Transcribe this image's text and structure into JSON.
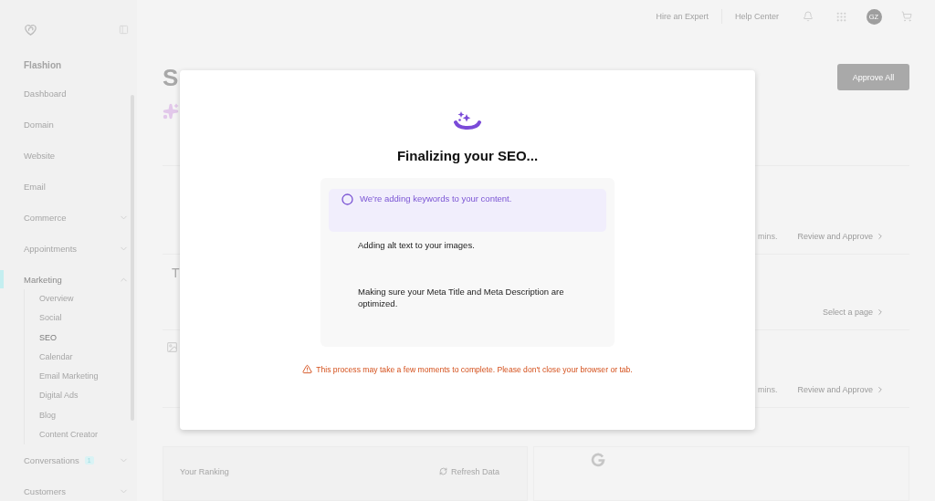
{
  "sidebar": {
    "site": "Flashion",
    "items": [
      {
        "label": "Dashboard",
        "kind": "link",
        "selected": false
      },
      {
        "label": "Domain",
        "kind": "link",
        "selected": false
      },
      {
        "label": "Website",
        "kind": "link",
        "selected": false
      },
      {
        "label": "Email",
        "kind": "link",
        "selected": false
      },
      {
        "label": "Commerce",
        "kind": "group",
        "expanded": false,
        "selected": false
      },
      {
        "label": "Appointments",
        "kind": "group",
        "expanded": false,
        "selected": false
      },
      {
        "label": "Marketing",
        "kind": "group",
        "expanded": true,
        "selected": true,
        "children": [
          {
            "label": "Overview",
            "selected": false
          },
          {
            "label": "Social",
            "selected": false
          },
          {
            "label": "SEO",
            "selected": true
          },
          {
            "label": "Calendar",
            "selected": false
          },
          {
            "label": "Email Marketing",
            "selected": false
          },
          {
            "label": "Digital Ads",
            "selected": false
          },
          {
            "label": "Blog",
            "selected": false
          },
          {
            "label": "Content Creator",
            "selected": false
          }
        ]
      },
      {
        "label": "Conversations",
        "kind": "group",
        "expanded": false,
        "selected": false,
        "badge": "1"
      },
      {
        "label": "Customers",
        "kind": "group",
        "expanded": false,
        "selected": false
      }
    ]
  },
  "header": {
    "links": [
      "Hire an Expert",
      "Help Center"
    ],
    "avatar": "GZ"
  },
  "page": {
    "title": "S",
    "approve_button": "Approve All",
    "rows": [
      {
        "kind": "task",
        "duration": "mins.",
        "action": "Review and Approve"
      },
      {
        "kind": "page",
        "heading": "T",
        "action": "Select a page"
      },
      {
        "kind": "image",
        "duration": "mins.",
        "action": "Review and Approve"
      }
    ],
    "ranking": {
      "title": "Your Ranking",
      "refresh": "Refresh Data"
    }
  },
  "modal": {
    "title": "Finalizing your SEO...",
    "steps": [
      {
        "text": "We're adding keywords to your content.",
        "selected": true
      },
      {
        "text": "Adding alt text to your images.",
        "selected": false
      },
      {
        "text": "Making sure your Meta Title and Meta Description are optimized.",
        "selected": false
      }
    ],
    "warning": "This process may take a few moments to complete. Please don't close your browser or tab."
  }
}
